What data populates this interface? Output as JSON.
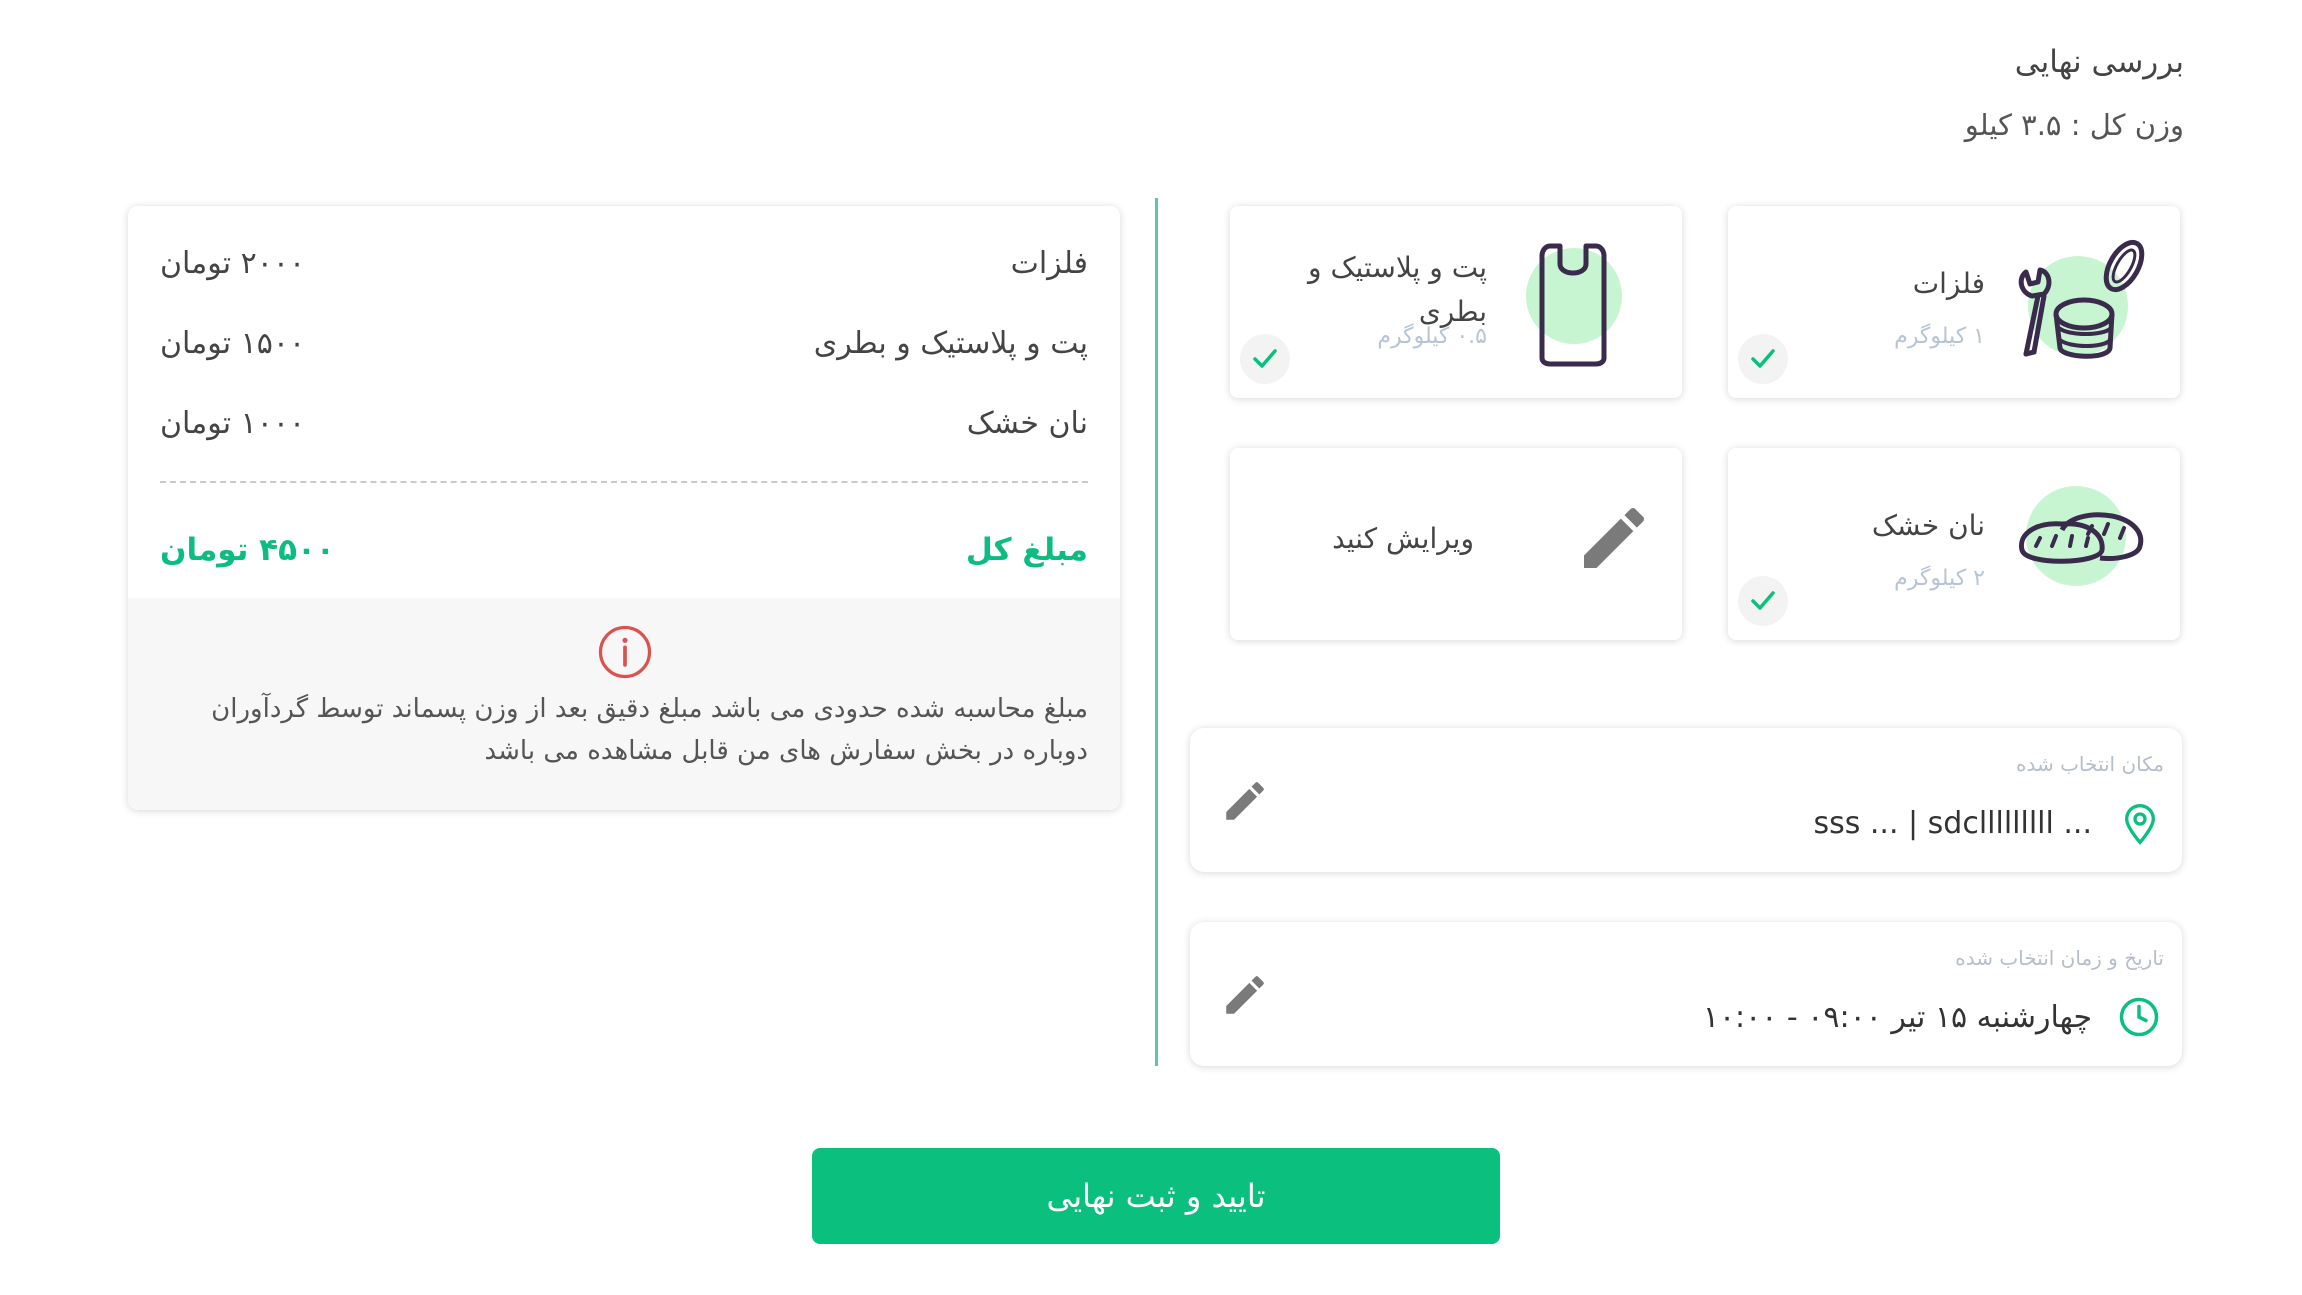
{
  "header": {
    "title": "بررسی نهایی",
    "total_weight": "وزن کل : ۳.۵ کیلو"
  },
  "categories": [
    {
      "name": "فلزات",
      "weight": "۱ کیلوگرم",
      "icon": "can-wrench-icon",
      "selected": true
    },
    {
      "name": "پت و پلاستیک و بطری",
      "weight": "۰.۵ کیلوگرم",
      "icon": "plastic-bag-icon",
      "selected": true
    },
    {
      "name": "نان خشک",
      "weight": "۲ کیلوگرم",
      "icon": "bread-icon",
      "selected": true
    }
  ],
  "edit_card": {
    "label": "ویرایش کنید",
    "icon": "pencil-icon"
  },
  "location": {
    "caption": "مکان انتخاب شده",
    "value": "sss ... | sdclllllllll ...",
    "icon": "map-pin-icon"
  },
  "datetime": {
    "caption": "تاریخ و زمان انتخاب شده",
    "value": "چهارشنبه ۱۵ تیر ۰۹:۰۰ - ۱۰:۰۰",
    "icon": "clock-icon"
  },
  "summary": {
    "rows": [
      {
        "name": "فلزات",
        "price": "۲۰۰۰ تومان"
      },
      {
        "name": "پت و پلاستیک و بطری",
        "price": "۱۵۰۰ تومان"
      },
      {
        "name": "نان خشک",
        "price": "۱۰۰۰ تومان"
      }
    ],
    "total_label": "مبلغ کل",
    "total_value": "۴۵۰۰ تومان",
    "notice": "مبلغ محاسبه شده حدودی می باشد مبلغ دقیق بعد از وزن پسماند توسط گردآوران دوباره در بخش سفارش های من قابل مشاهده می باشد",
    "notice_icon": "info-icon"
  },
  "confirm_button": {
    "label": "تایید و ثبت نهایی"
  },
  "colors": {
    "accent": "#0bbf7f",
    "divider": "#5ec7a5",
    "icon_blob": "#c8f5d1",
    "icon_stroke": "#3a2b4d",
    "notice_red": "#d9534f"
  }
}
